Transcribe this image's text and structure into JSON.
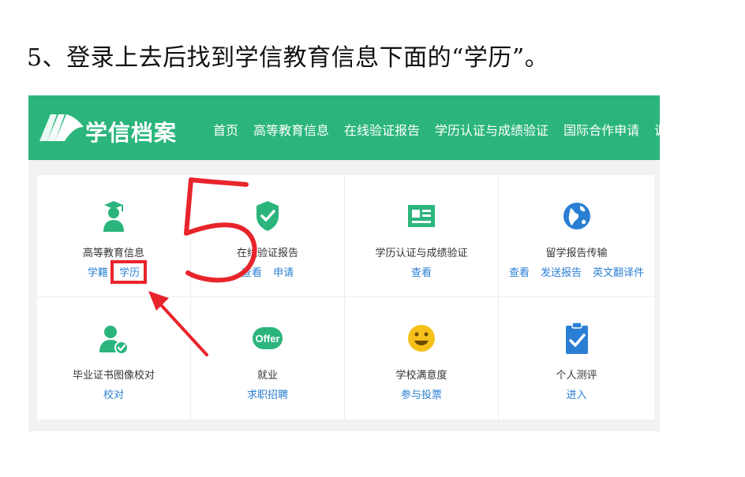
{
  "caption": "5、登录上去后找到学信教育信息下面的“学历”。",
  "header": {
    "brand": "学信档案",
    "nav": [
      "首页",
      "高等教育信息",
      "在线验证报告",
      "学历认证与成绩验证",
      "国际合作申请",
      "调查/投票"
    ]
  },
  "cards": [
    {
      "title": "高等教育信息",
      "icon": "graduate-icon",
      "links": [
        "学籍",
        "学历"
      ]
    },
    {
      "title": "在线验证报告",
      "icon": "shield-check-icon",
      "links": [
        "查看",
        "申请"
      ]
    },
    {
      "title": "学历认证与成绩验证",
      "icon": "id-card-icon",
      "links": [
        "查看"
      ]
    },
    {
      "title": "留学报告传输",
      "icon": "globe-icon",
      "links": [
        "查看",
        "发送报告",
        "英文翻译件"
      ]
    },
    {
      "title": "毕业证书图像校对",
      "icon": "user-check-icon",
      "links": [
        "校对"
      ]
    },
    {
      "title": "就业",
      "icon": "offer-icon",
      "icon_text": "Offer",
      "links": [
        "求职招聘"
      ]
    },
    {
      "title": "学校满意度",
      "icon": "smiley-icon",
      "links": [
        "参与投票"
      ]
    },
    {
      "title": "个人测评",
      "icon": "clipboard-check-icon",
      "links": [
        "进入"
      ]
    }
  ],
  "annotation": {
    "handwritten": "5",
    "color": "#e8242b"
  },
  "colors": {
    "brand_green": "#2bb57c",
    "link_blue": "#2a7fd4",
    "icon_green": "#2bb57c",
    "icon_blue": "#2a7fd4",
    "icon_yellow": "#f5c01a"
  }
}
